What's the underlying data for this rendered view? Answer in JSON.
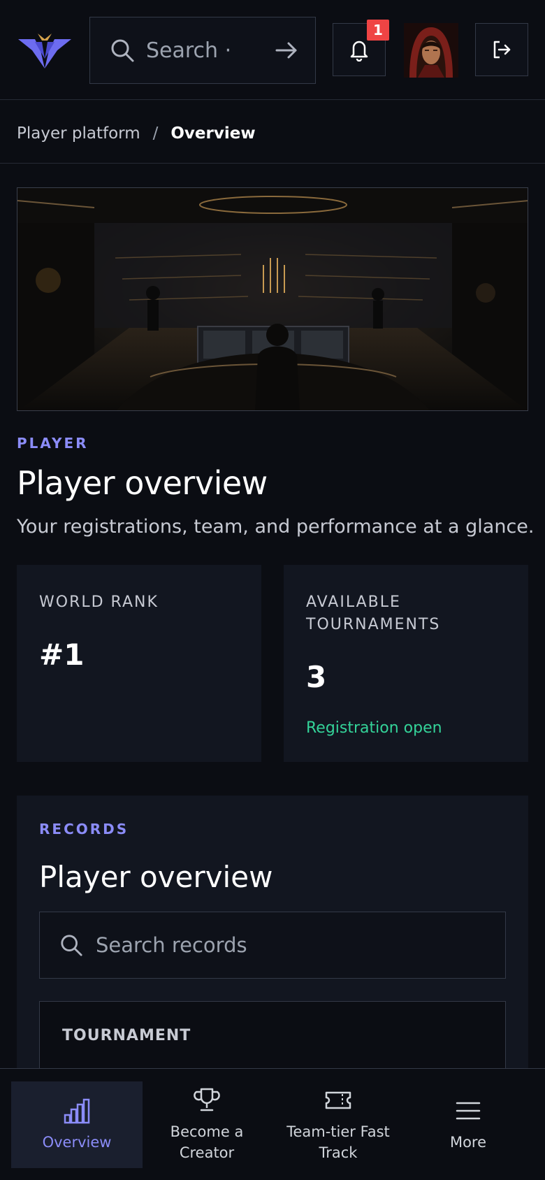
{
  "header": {
    "search": {
      "placeholder": "Search ·"
    },
    "notifications": {
      "count": "1"
    },
    "accent_color": "#8b8cf8"
  },
  "breadcrumb": {
    "parent": "Player platform",
    "separator": "/",
    "current": "Overview"
  },
  "intro": {
    "eyebrow": "PLAYER",
    "title": "Player overview",
    "subtitle": "Your registrations, team, and performance at a glance."
  },
  "stats": [
    {
      "label": "WORLD RANK",
      "value": "#1",
      "note": ""
    },
    {
      "label": "AVAILABLE TOURNAMENTS",
      "value": "3",
      "note": "Registration open"
    }
  ],
  "records": {
    "eyebrow": "RECORDS",
    "title": "Player overview",
    "search_placeholder": "Search records",
    "columns": [
      "TOURNAMENT"
    ]
  },
  "bottom_nav": {
    "items": [
      {
        "label": "Overview",
        "icon": "bar-chart-icon",
        "active": true
      },
      {
        "label": "Become a Creator",
        "icon": "trophy-icon",
        "active": false
      },
      {
        "label": "Team-tier Fast Track",
        "icon": "ticket-icon",
        "active": false
      },
      {
        "label": "More",
        "icon": "menu-icon",
        "active": false
      }
    ]
  },
  "colors": {
    "background": "#0b0d13",
    "card": "#121620",
    "accent": "#8b8cf8",
    "success": "#34d399",
    "badge": "#ef4444"
  }
}
